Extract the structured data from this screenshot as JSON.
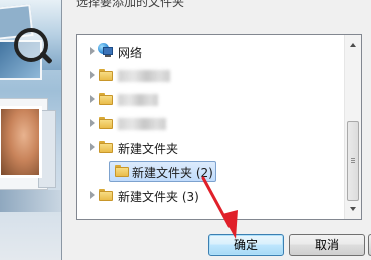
{
  "dialog": {
    "title": "选择要添加的文件夹"
  },
  "tree": {
    "items": [
      {
        "label": "网络",
        "icon": "network-icon",
        "expandable": true
      },
      {
        "label": "",
        "icon": "folder-icon",
        "expandable": true,
        "blurred": true
      },
      {
        "label": "",
        "icon": "folder-icon",
        "expandable": true,
        "blurred": true
      },
      {
        "label": "",
        "icon": "folder-icon",
        "expandable": true,
        "blurred": true
      },
      {
        "label": "新建文件夹",
        "icon": "folder-icon",
        "expandable": true
      },
      {
        "label": "新建文件夹 (2)",
        "icon": "folder-icon",
        "expandable": false,
        "selected": true
      },
      {
        "label": "新建文件夹 (3)",
        "icon": "folder-icon",
        "expandable": true
      }
    ]
  },
  "buttons": {
    "ok_label": "确定",
    "cancel_label": "取消"
  },
  "colors": {
    "annotation_arrow": "#e0202a",
    "selection": "#c1dcfc",
    "ok_border": "#3c7fb1"
  }
}
